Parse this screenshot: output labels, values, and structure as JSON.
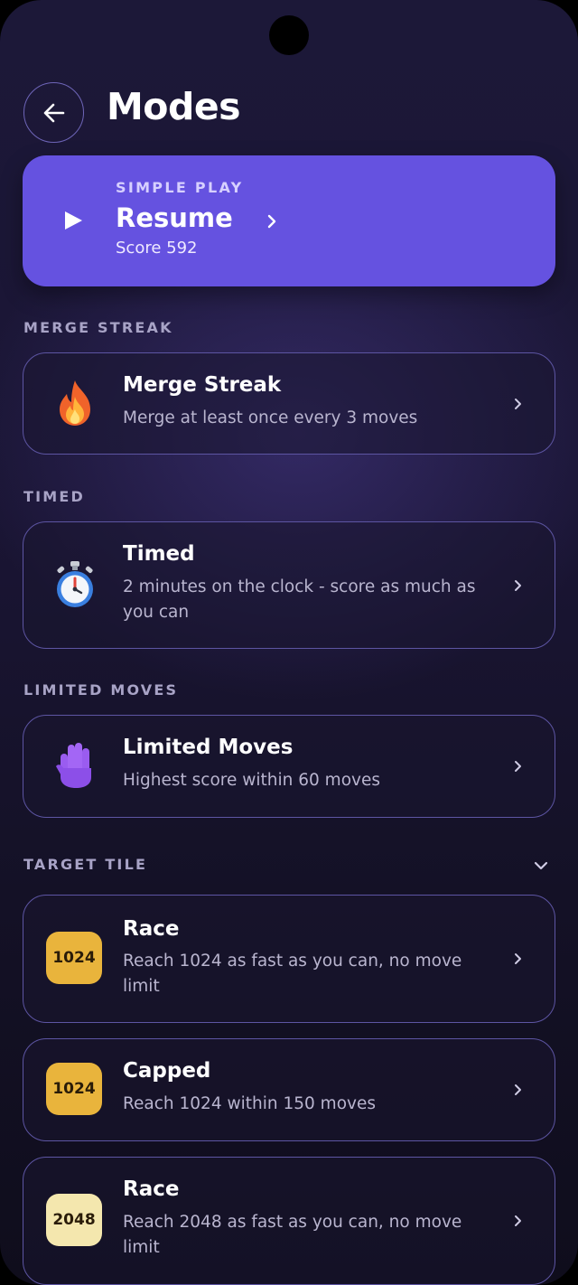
{
  "header": {
    "title": "Modes",
    "back_icon": "arrow-left-icon"
  },
  "hero": {
    "eyebrow": "SIMPLE PLAY",
    "title": "Resume",
    "score": "Score 592",
    "icon": "play-icon",
    "color": "#6552e0"
  },
  "sections": {
    "merge_streak": "MERGE STREAK",
    "timed": "TIMED",
    "limited_moves": "LIMITED MOVES",
    "target_tile": "TARGET TILE"
  },
  "cards": {
    "merge_streak": {
      "title": "Merge Streak",
      "desc": "Merge at least once every 3 moves",
      "icon": "fire-icon"
    },
    "timed": {
      "title": "Timed",
      "desc": "2 minutes on the clock - score as much as you can",
      "icon": "stopwatch-icon"
    },
    "limited_moves": {
      "title": "Limited Moves",
      "desc": "Highest score within 60 moves",
      "icon": "raised-hand-icon"
    },
    "race_1024": {
      "tile": "1024",
      "title": "Race",
      "desc": "Reach 1024 as fast as you can, no move limit",
      "tile_color": "#e9b43c"
    },
    "capped_1024": {
      "tile": "1024",
      "title": "Capped",
      "desc": "Reach 1024 within 150 moves",
      "tile_color": "#e9b43c"
    },
    "race_2048": {
      "tile": "2048",
      "title": "Race",
      "desc": "Reach 2048 as fast as you can, no move limit",
      "tile_color": "#f4e7ae"
    }
  }
}
